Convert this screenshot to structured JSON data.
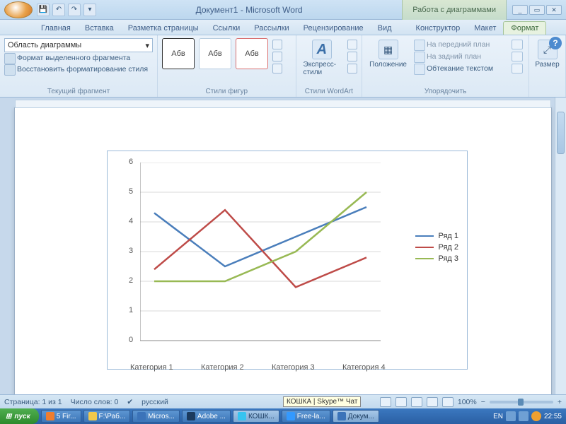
{
  "title": "Документ1 - Microsoft Word",
  "chart_tools_title": "Работа с диаграммами",
  "tabs": {
    "home": "Главная",
    "insert": "Вставка",
    "layout": "Разметка страницы",
    "references": "Ссылки",
    "mailings": "Рассылки",
    "review": "Рецензирование",
    "view": "Вид",
    "design": "Конструктор",
    "layout2": "Макет",
    "format": "Формат"
  },
  "ribbon": {
    "current_sel_group": "Текущий фрагмент",
    "chart_area_combo": "Область диаграммы",
    "format_selection": "Формат выделенного фрагмента",
    "reset_style": "Восстановить форматирование стиля",
    "shape_styles_group": "Стили фигур",
    "style_sample": "Абв",
    "wordart_group": "Стили WordArt",
    "express_styles": "Экспресс-стили",
    "arrange_group": "Упорядочить",
    "position": "Положение",
    "bring_front": "На передний план",
    "send_back": "На задний план",
    "text_wrap": "Обтекание текстом",
    "size_group": "Размер",
    "size": "Размер"
  },
  "chart_data": {
    "type": "line",
    "categories": [
      "Категория 1",
      "Категория 2",
      "Категория 3",
      "Категория 4"
    ],
    "series": [
      {
        "name": "Ряд 1",
        "color": "#4a7ebb",
        "values": [
          4.3,
          2.5,
          3.5,
          4.5
        ]
      },
      {
        "name": "Ряд 2",
        "color": "#be4b48",
        "values": [
          2.4,
          4.4,
          1.8,
          2.8
        ]
      },
      {
        "name": "Ряд 3",
        "color": "#98b954",
        "values": [
          2.0,
          2.0,
          3.0,
          5.0
        ]
      }
    ],
    "ylim": [
      0,
      6
    ],
    "yticks": [
      0,
      1,
      2,
      3,
      4,
      5,
      6
    ]
  },
  "status": {
    "page": "Страница: 1 из 1",
    "words": "Число слов: 0",
    "lang": "русский",
    "zoom": "100%"
  },
  "taskbar": {
    "start": "пуск",
    "items": [
      {
        "label": "5 Fir...",
        "icon": "#f07d2e"
      },
      {
        "label": "F:\\Раб...",
        "icon": "#f2c94c"
      },
      {
        "label": "Micros...",
        "icon": "#3b73b9"
      },
      {
        "label": "Adobe ...",
        "icon": "#1b3a5e"
      },
      {
        "label": "КОШК...",
        "icon": "#36c3f0",
        "active": true
      },
      {
        "label": "Free-la...",
        "icon": "#3399ff"
      },
      {
        "label": "Докум...",
        "icon": "#3b73b9",
        "active": true
      }
    ],
    "lang_ind": "EN",
    "clock": "22:55",
    "tooltip": "КОШКА | Skype™ Чат"
  }
}
